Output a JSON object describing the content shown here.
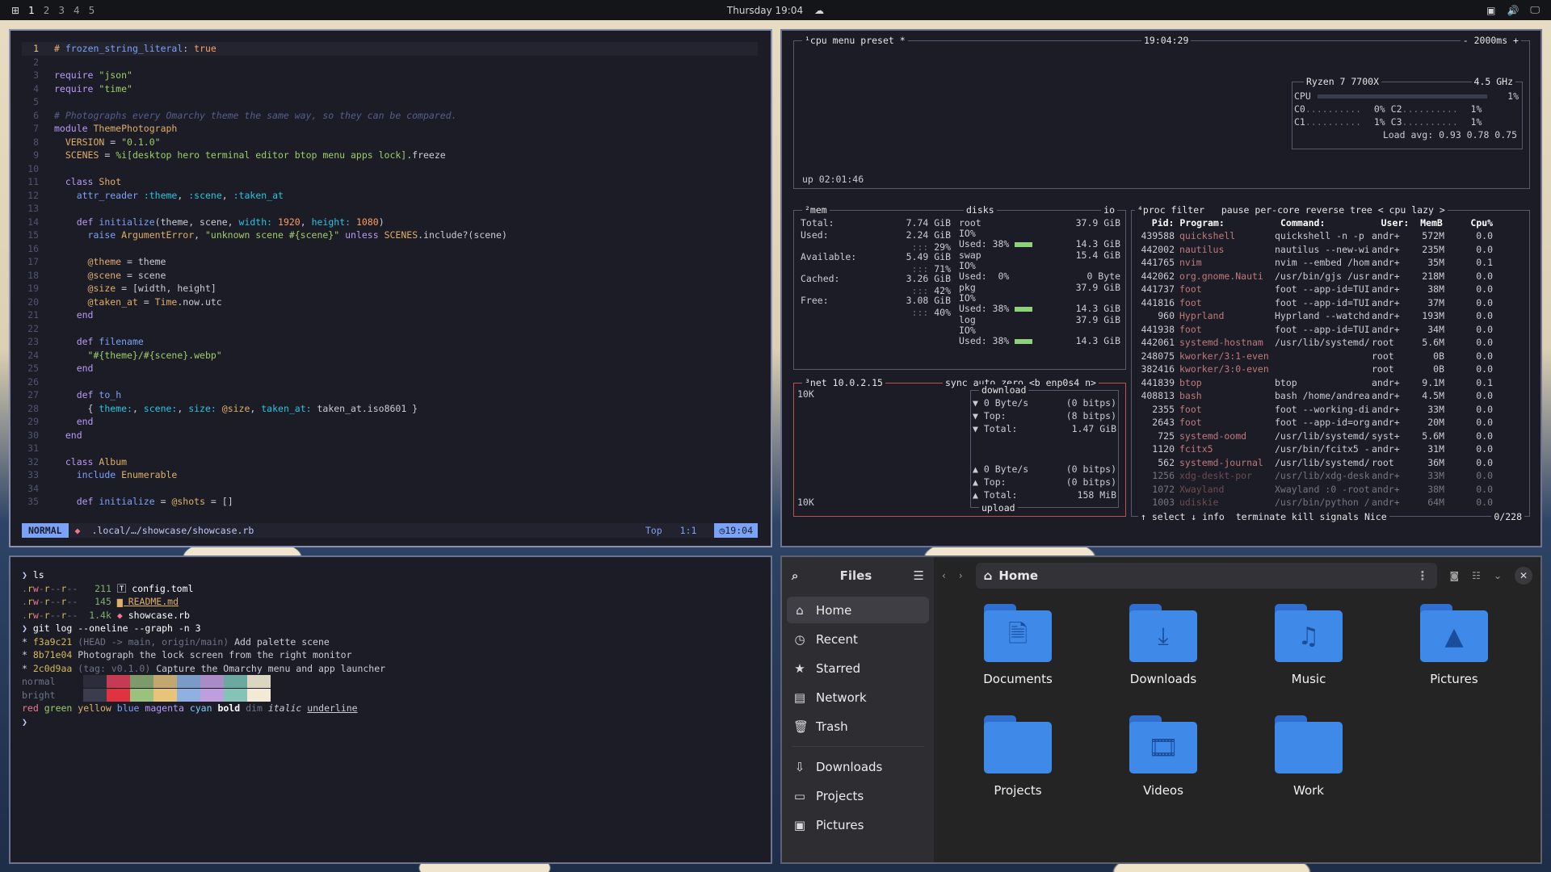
{
  "topbar": {
    "workspaces": [
      "1",
      "2",
      "3",
      "4",
      "5"
    ],
    "active_workspace": "1",
    "clock": "Thursday 19:04"
  },
  "editor": {
    "lines": [
      {
        "n": "1",
        "html": "<span class='t'>#</span> <span class='f'>frozen_string_literal</span>: <span class='o'>true</span>"
      },
      {
        "n": "2",
        "html": ""
      },
      {
        "n": "3",
        "html": "<span class='k'>require</span> <span class='s'>\"json\"</span>"
      },
      {
        "n": "4",
        "html": "<span class='k'>require</span> <span class='s'>\"time\"</span>"
      },
      {
        "n": "5",
        "html": ""
      },
      {
        "n": "6",
        "html": "<span class='cm'># Photographs every Omarchy theme the same way, so they can be compared.</span>"
      },
      {
        "n": "7",
        "html": "<span class='k'>module</span> <span class='t'>ThemePhotograph</span>"
      },
      {
        "n": "8",
        "html": "  <span class='t'>VERSION</span> = <span class='s'>\"0.1.0\"</span>"
      },
      {
        "n": "9",
        "html": "  <span class='t'>SCENES</span> = <span class='s'>%i[desktop hero terminal editor btop menu apps lock]</span>.freeze"
      },
      {
        "n": "10",
        "html": ""
      },
      {
        "n": "11",
        "html": "  <span class='k'>class</span> <span class='t'>Shot</span>"
      },
      {
        "n": "12",
        "html": "    <span class='f'>attr_reader</span> <span class='sym'>:theme</span>, <span class='sym'>:scene</span>, <span class='sym'>:taken_at</span>"
      },
      {
        "n": "13",
        "html": ""
      },
      {
        "n": "14",
        "html": "    <span class='k'>def</span> <span class='f'>initialize</span>(theme, scene, <span class='sym'>width:</span> <span class='o'>1920</span>, <span class='sym'>height:</span> <span class='o'>1080</span>)"
      },
      {
        "n": "15",
        "html": "      <span class='f'>raise</span> <span class='t'>ArgumentError</span>, <span class='s'>\"unknown scene #{scene}\"</span> <span class='k'>unless</span> <span class='t'>SCENES</span>.include?(scene)"
      },
      {
        "n": "16",
        "html": ""
      },
      {
        "n": "17",
        "html": "      <span class='vr'>@theme</span> = theme"
      },
      {
        "n": "18",
        "html": "      <span class='vr'>@scene</span> = scene"
      },
      {
        "n": "19",
        "html": "      <span class='vr'>@size</span> = [width, height]"
      },
      {
        "n": "20",
        "html": "      <span class='vr'>@taken_at</span> = <span class='t'>Time</span>.now.utc"
      },
      {
        "n": "21",
        "html": "    <span class='k'>end</span>"
      },
      {
        "n": "22",
        "html": ""
      },
      {
        "n": "23",
        "html": "    <span class='k'>def</span> <span class='f'>filename</span>"
      },
      {
        "n": "24",
        "html": "      <span class='s'>\"#{theme}/#{scene}.webp\"</span>"
      },
      {
        "n": "25",
        "html": "    <span class='k'>end</span>"
      },
      {
        "n": "26",
        "html": ""
      },
      {
        "n": "27",
        "html": "    <span class='k'>def</span> <span class='f'>to_h</span>"
      },
      {
        "n": "28",
        "html": "      { <span class='sym'>theme:</span>, <span class='sym'>scene:</span>, <span class='sym'>size:</span> <span class='vr'>@size</span>, <span class='sym'>taken_at:</span> taken_at.iso8601 }"
      },
      {
        "n": "29",
        "html": "    <span class='k'>end</span>"
      },
      {
        "n": "30",
        "html": "  <span class='k'>end</span>"
      },
      {
        "n": "31",
        "html": ""
      },
      {
        "n": "32",
        "html": "  <span class='k'>class</span> <span class='t'>Album</span>"
      },
      {
        "n": "33",
        "html": "    <span class='f'>include</span> <span class='t'>Enumerable</span>"
      },
      {
        "n": "34",
        "html": ""
      },
      {
        "n": "35",
        "html": "    <span class='k'>def</span> <span class='f'>initialize</span> = <span class='vr'>@shots</span> = []"
      }
    ],
    "mode": "NORMAL",
    "path": ".local/…/showcase/showcase.rb",
    "position_label": "Top",
    "cursor": "1:1",
    "time": "19:04"
  },
  "btop": {
    "cpu_title": "¹cpu",
    "menu": "menu",
    "preset": "preset *",
    "time": "19:04:29",
    "interval": "- 2000ms +",
    "uptime": "up 02:01:46",
    "cpu_name": "Ryzen 7 7700X",
    "freq": "4.5 GHz",
    "cpu_rows": [
      {
        "l": "CPU",
        "v": "1%"
      },
      {
        "l": "C0",
        "v": "0%",
        "l2": "C2",
        "v2": "1%"
      },
      {
        "l": "C1",
        "v": "1%",
        "l2": "C3",
        "v2": "1%"
      }
    ],
    "load": "Load avg: 0.93 0.78 0.75",
    "mem": [
      {
        "l": "Total:",
        "v": "7.74 GiB"
      },
      {
        "l": "Used:",
        "v": "2.24 GiB",
        "p": "29%"
      },
      {
        "l": "Available:",
        "v": "5.49 GiB",
        "p": "71%"
      },
      {
        "l": "Cached:",
        "v": "3.26 GiB",
        "p": "42%"
      },
      {
        "l": "Free:",
        "v": "3.08 GiB",
        "p": "40%"
      }
    ],
    "disks": [
      {
        "n": "root",
        "s": "37.9 GiB",
        "u": "Used: 38%",
        "uv": "14.3 GiB"
      },
      {
        "n": "swap",
        "s": "15.4 GiB",
        "u": "Used:  0%",
        "uv": "0 Byte"
      },
      {
        "n": "pkg",
        "s": "37.9 GiB",
        "u": "Used: 38%",
        "uv": "14.3 GiB"
      },
      {
        "n": "log",
        "s": "37.9 GiB",
        "u": "Used: 38%",
        "uv": "14.3 GiB"
      }
    ],
    "net": {
      "title": "³net",
      "ip": "10.0.2.15",
      "opts": "sync auto zero <b enp0s4 n>",
      "scale": "10K",
      "download": "download",
      "upload": "upload",
      "dl": [
        {
          "l": "▼ 0 Byte/s",
          "v": "(0 bitps)"
        },
        {
          "l": "▼ Top:",
          "v": "(8 bitps)"
        },
        {
          "l": "▼ Total:",
          "v": "1.47 GiB"
        }
      ],
      "ul": [
        {
          "l": "▲ 0 Byte/s",
          "v": "(0 bitps)"
        },
        {
          "l": "▲ Top:",
          "v": "(0 bitps)"
        },
        {
          "l": "▲ Total:",
          "v": "158 MiB"
        }
      ]
    },
    "proc_title": "⁴proc filter   pause per-core reverse tree < cpu lazy >",
    "proc_header": "   Pid: Program:          Command:          User:  MemB     Cpu%",
    "procs": [
      [
        "439588",
        "quickshell",
        "quickshell -n -p /",
        "andr+",
        "572M",
        "0.0"
      ],
      [
        "442002",
        "nautilus",
        "nautilus --new-win",
        "andr+",
        "235M",
        "0.0"
      ],
      [
        "441765",
        "nvim",
        "nvim --embed /home",
        "andr+",
        "35M",
        "0.1"
      ],
      [
        "442062",
        "org.gnome.Nauti",
        "/usr/bin/gjs /usr/",
        "andr+",
        "218M",
        "0.0"
      ],
      [
        "441737",
        "foot",
        "foot --app-id=TUI.",
        "andr+",
        "38M",
        "0.0"
      ],
      [
        "441816",
        "foot",
        "foot --app-id=TUI.",
        "andr+",
        "37M",
        "0.0"
      ],
      [
        "960",
        "Hyprland",
        "Hyprland --watchdo",
        "andr+",
        "193M",
        "0.0"
      ],
      [
        "441938",
        "foot",
        "foot --app-id=TUI.",
        "andr+",
        "34M",
        "0.0"
      ],
      [
        "442061",
        "systemd-hostnam",
        "/usr/lib/systemd/s",
        "root",
        "5.6M",
        "0.0"
      ],
      [
        "248075",
        "kworker/3:1-even",
        "",
        "root",
        "0B",
        "0.0"
      ],
      [
        "382416",
        "kworker/3:0-even",
        "",
        "root",
        "0B",
        "0.0"
      ],
      [
        "441839",
        "btop",
        "btop",
        "andr+",
        "9.1M",
        "0.1"
      ],
      [
        "408813",
        "bash",
        "bash /home/andreas",
        "andr+",
        "4.5M",
        "0.0"
      ],
      [
        "2355",
        "foot",
        "foot --working-dir",
        "andr+",
        "33M",
        "0.0"
      ],
      [
        "2643",
        "foot",
        "foot --app-id=org.",
        "andr+",
        "20M",
        "0.0"
      ],
      [
        "725",
        "systemd-oomd",
        "/usr/lib/systemd/s",
        "syst+",
        "5.6M",
        "0.0"
      ],
      [
        "1120",
        "fcitx5",
        "/usr/bin/fcitx5 --",
        "andr+",
        "31M",
        "0.0"
      ],
      [
        "562",
        "systemd-journal",
        "/usr/lib/systemd/s",
        "root",
        "36M",
        "0.0"
      ],
      [
        "1256",
        "xdg-deskt-por",
        "/usr/lib/xdg-deskt",
        "andr+",
        "33M",
        "0.0"
      ],
      [
        "1072",
        "Xwayland",
        "Xwayland :0 -rootl",
        "andr+",
        "38M",
        "0.0"
      ],
      [
        "1003",
        "udiskie",
        "/usr/bin/python /u",
        "andr+",
        "64M",
        "0.0"
      ]
    ],
    "proc_footer": "↑ select ↓ info  terminate kill signals Nice",
    "proc_count": "0/228"
  },
  "terminal": {
    "lines": [
      {
        "html": "<span style='color:#c0caf5'>❯</span> <span style='color:#fff'>ls</span>"
      },
      {
        "html": "<span class='dim'>.</span><span class='yel'>r</span><span style='color:#f7768e'>w</span><span class='dim'>-</span><span class='yel'>r</span><span class='dim'>--</span><span class='yel'>r</span><span class='dim'>--</span>   <span class='grn'>211</span> <span style='color:#fff'>🅃 config.toml</span>"
      },
      {
        "html": "<span class='dim'>.</span><span class='yel'>r</span><span style='color:#f7768e'>w</span><span class='dim'>-</span><span class='yel'>r</span><span class='dim'>--</span><span class='yel'>r</span><span class='dim'>--</span>   <span class='grn'>145</span> <span style='color:#e0af68;text-decoration:underline'>▆ README.md</span>"
      },
      {
        "html": "<span class='dim'>.</span><span class='yel'>r</span><span style='color:#f7768e'>w</span><span class='dim'>-</span><span class='yel'>r</span><span class='dim'>--</span><span class='yel'>r</span><span class='dim'>--</span>  <span class='grn'>1.4k</span> <span style='color:#f7768e'>◆</span> <span style='color:#fff'>showcase.rb</span>"
      },
      {
        "html": "<span style='color:#c0caf5'>❯</span> <span style='color:#fff'>git log --oneline --graph -n 3</span>"
      },
      {
        "html": "* <span class='yel'>f3a9c21</span> <span class='dim'>(HEAD -> main, origin/main)</span> Add palette scene"
      },
      {
        "html": "* <span class='yel'>8b71e04</span> Photograph the lock screen from the right monitor"
      },
      {
        "html": "* <span class='yel'>2c0d9aa</span> <span class='dim'>(tag: v0.1.0)</span> Capture the Omarchy menu and app launcher"
      }
    ],
    "normal": "normal",
    "bright": "bright",
    "colors_line": "<span style='color:#f7768e'>red</span> <span style='color:#9ece6a'>green</span> <span style='color:#e0af68'>yellow</span> <span style='color:#7aa2f7'>blue</span> <span style='color:#bb9af7'>magenta</span> <span style='color:#7dcfff'>cyan</span> <b style='color:#fff'>bold</b> <span class='dim'>dim</span> <i>italic</i> <u>underline</u>",
    "prompt": "❯",
    "normal_swatches": [
      "#2b2d3a",
      "#c53b53",
      "#7c9a6a",
      "#c2a86e",
      "#7a9ac8",
      "#a98bc6",
      "#6aa8a0",
      "#dcd5c0"
    ],
    "bright_swatches": [
      "#3b3d4c",
      "#e0323f",
      "#9ac27d",
      "#e8c478",
      "#8fb0e0",
      "#bf9ee0",
      "#86c2b5",
      "#f2ead6"
    ]
  },
  "files": {
    "title": "Files",
    "location": "Home",
    "sidebar": [
      {
        "icon": "home-icon",
        "g": "⌂",
        "label": "Home",
        "sel": true
      },
      {
        "icon": "clock-icon",
        "g": "◷",
        "label": "Recent"
      },
      {
        "icon": "star-icon",
        "g": "★",
        "label": "Starred"
      },
      {
        "icon": "network-icon",
        "g": "▤",
        "label": "Network"
      },
      {
        "icon": "trash-icon",
        "g": "🗑",
        "label": "Trash"
      }
    ],
    "bookmarks": [
      {
        "icon": "download-icon",
        "g": "⇩",
        "label": "Downloads"
      },
      {
        "icon": "folder-icon",
        "g": "▭",
        "label": "Projects"
      },
      {
        "icon": "image-icon",
        "g": "▣",
        "label": "Pictures"
      }
    ],
    "folders": [
      {
        "label": "Documents",
        "g": "🗎"
      },
      {
        "label": "Downloads",
        "g": "⤓"
      },
      {
        "label": "Music",
        "g": "♫"
      },
      {
        "label": "Pictures",
        "g": "▲"
      },
      {
        "label": "Projects",
        "g": ""
      },
      {
        "label": "Videos",
        "g": "🎞"
      },
      {
        "label": "Work",
        "g": ""
      }
    ]
  }
}
